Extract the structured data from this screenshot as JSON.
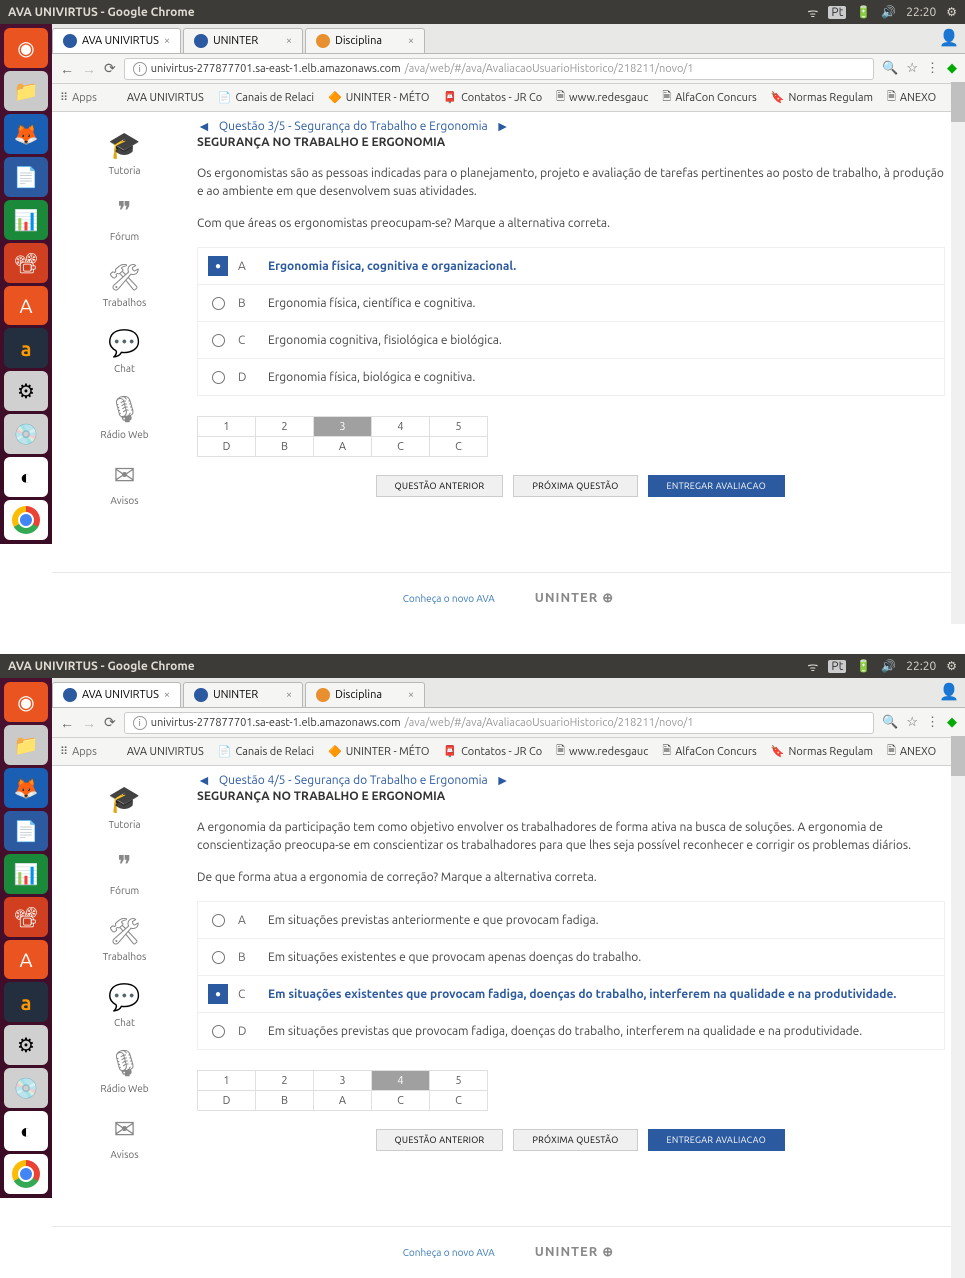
{
  "window_title": "AVA UNIVIRTUS - Google Chrome",
  "time": "22:20",
  "kb_indicator": "Pt",
  "browser_tabs": [
    {
      "label": "AVA UNIVIRTUS",
      "active": true,
      "icon": "blue"
    },
    {
      "label": "UNINTER",
      "active": false,
      "icon": "blue"
    },
    {
      "label": "Disciplina",
      "active": false,
      "icon": "orange"
    }
  ],
  "url_prefix": "univirtus-277877701.sa-east-1.elb.amazonaws.com",
  "url_path": "/ava/web/#/ava/AvaliacaoUsuarioHistorico/218211/novo/1",
  "bookmarks": [
    {
      "label": "Apps",
      "kind": "apps"
    },
    {
      "label": "AVA UNIVIRTUS"
    },
    {
      "label": "Canais de Relaci"
    },
    {
      "label": "UNINTER - MÉTO"
    },
    {
      "label": "Contatos - JR Co"
    },
    {
      "label": "www.redesgauc"
    },
    {
      "label": "AlfaCon Concurs"
    },
    {
      "label": "Normas Regulam"
    },
    {
      "label": "ANEXO"
    }
  ],
  "sidebar": [
    {
      "label": "Tutoria",
      "icon": "🎓"
    },
    {
      "label": "Fórum",
      "icon": "❞"
    },
    {
      "label": "Trabalhos",
      "icon": "🛠"
    },
    {
      "label": "Chat",
      "icon": "💬"
    },
    {
      "label": "Rádio Web",
      "icon": "🎙"
    },
    {
      "label": "Avisos",
      "icon": "✉"
    }
  ],
  "footer": {
    "link": "Conheça o novo AVA",
    "brand": "UNINTER ⊕"
  },
  "q1": {
    "nav_title": "Questão 3/5 - Segurança do Trabalho e Ergonomia",
    "subject": "SEGURANÇA NO TRABALHO E ERGONOMIA",
    "paragraph1": "Os ergonomistas são as pessoas indicadas para o planejamento, projeto e avaliação de tarefas pertinentes ao posto de trabalho, à produção e ao ambiente em que desenvolvem suas atividades.",
    "paragraph2": "Com que áreas os ergonomistas preocupam-se? Marque a alternativa correta.",
    "options": [
      {
        "letter": "A",
        "text": "Ergonomia física, cognitiva e organizacional.",
        "selected": true
      },
      {
        "letter": "B",
        "text": "Ergonomia física, científica e cognitiva.",
        "selected": false
      },
      {
        "letter": "C",
        "text": "Ergonomia cognitiva, fisiológica e biológica.",
        "selected": false
      },
      {
        "letter": "D",
        "text": "Ergonomia física, biológica e cognitiva.",
        "selected": false
      }
    ],
    "grid_nums": [
      "1",
      "2",
      "3",
      "4",
      "5"
    ],
    "grid_ans": [
      "D",
      "B",
      "A",
      "C",
      "C"
    ],
    "current_q": 3,
    "btn_prev": "QUESTÃO ANTERIOR",
    "btn_next": "PRÓXIMA QUESTÃO",
    "btn_submit": "ENTREGAR AVALIACAO"
  },
  "q2": {
    "nav_title": "Questão 4/5 - Segurança do Trabalho e Ergonomia",
    "subject": "SEGURANÇA NO TRABALHO E ERGONOMIA",
    "paragraph1": "A ergonomia da participação tem como objetivo envolver os trabalhadores de forma ativa na busca de soluções. A ergonomia de conscientização preocupa-se em conscientizar os trabalhadores para que lhes seja possível reconhecer e corrigir os problemas diários.",
    "paragraph2": "De que forma atua a ergonomia de correção? Marque a alternativa correta.",
    "options": [
      {
        "letter": "A",
        "text": "Em situações previstas anteriormente e que provocam fadiga.",
        "selected": false
      },
      {
        "letter": "B",
        "text": "Em situações existentes e que provocam apenas doenças do trabalho.",
        "selected": false
      },
      {
        "letter": "C",
        "text": "Em situações existentes que provocam fadiga, doenças do trabalho, interferem na qualidade e na produtividade.",
        "selected": true
      },
      {
        "letter": "D",
        "text": "Em situações previstas que provocam fadiga, doenças do trabalho, interferem na qualidade e na produtividade.",
        "selected": false
      }
    ],
    "grid_nums": [
      "1",
      "2",
      "3",
      "4",
      "5"
    ],
    "grid_ans": [
      "D",
      "B",
      "A",
      "C",
      "C"
    ],
    "current_q": 4,
    "btn_prev": "QUESTÃO ANTERIOR",
    "btn_next": "PRÓXIMA QUESTÃO",
    "btn_submit": "ENTREGAR AVALIACAO"
  }
}
